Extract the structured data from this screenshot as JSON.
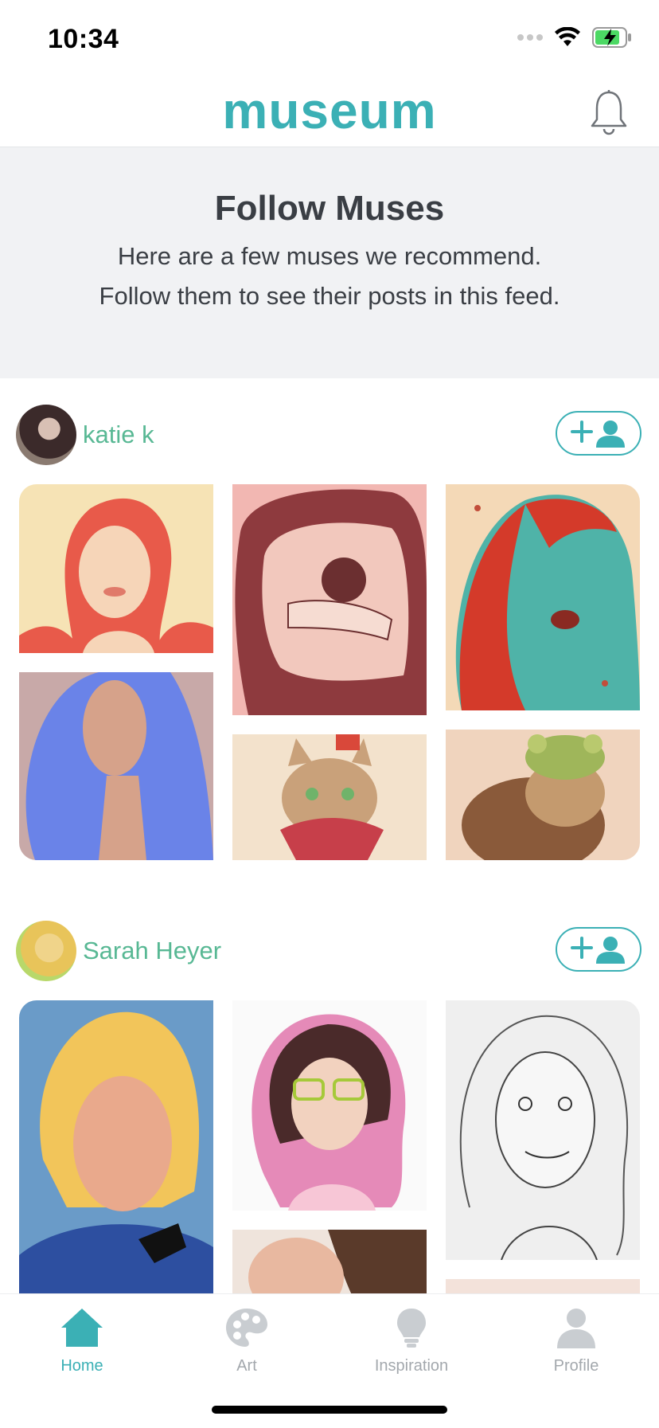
{
  "status_bar": {
    "time": "10:34"
  },
  "header": {
    "brand": "museum"
  },
  "banner": {
    "title": "Follow Muses",
    "line1": "Here are a few muses we recommend.",
    "line2": "Follow them to see their posts in this feed."
  },
  "muses": [
    {
      "name": "katie k"
    },
    {
      "name": "Sarah Heyer"
    }
  ],
  "tabs": [
    {
      "label": "Home",
      "icon": "home-icon",
      "active": true
    },
    {
      "label": "Art",
      "icon": "palette-icon",
      "active": false
    },
    {
      "label": "Inspiration",
      "icon": "lightbulb-icon",
      "active": false
    },
    {
      "label": "Profile",
      "icon": "person-icon",
      "active": false
    }
  ],
  "colors": {
    "accent": "#3bb0b5",
    "name": "#58b894",
    "banner_bg": "#f1f2f4",
    "inactive": "#a3a8ad"
  }
}
